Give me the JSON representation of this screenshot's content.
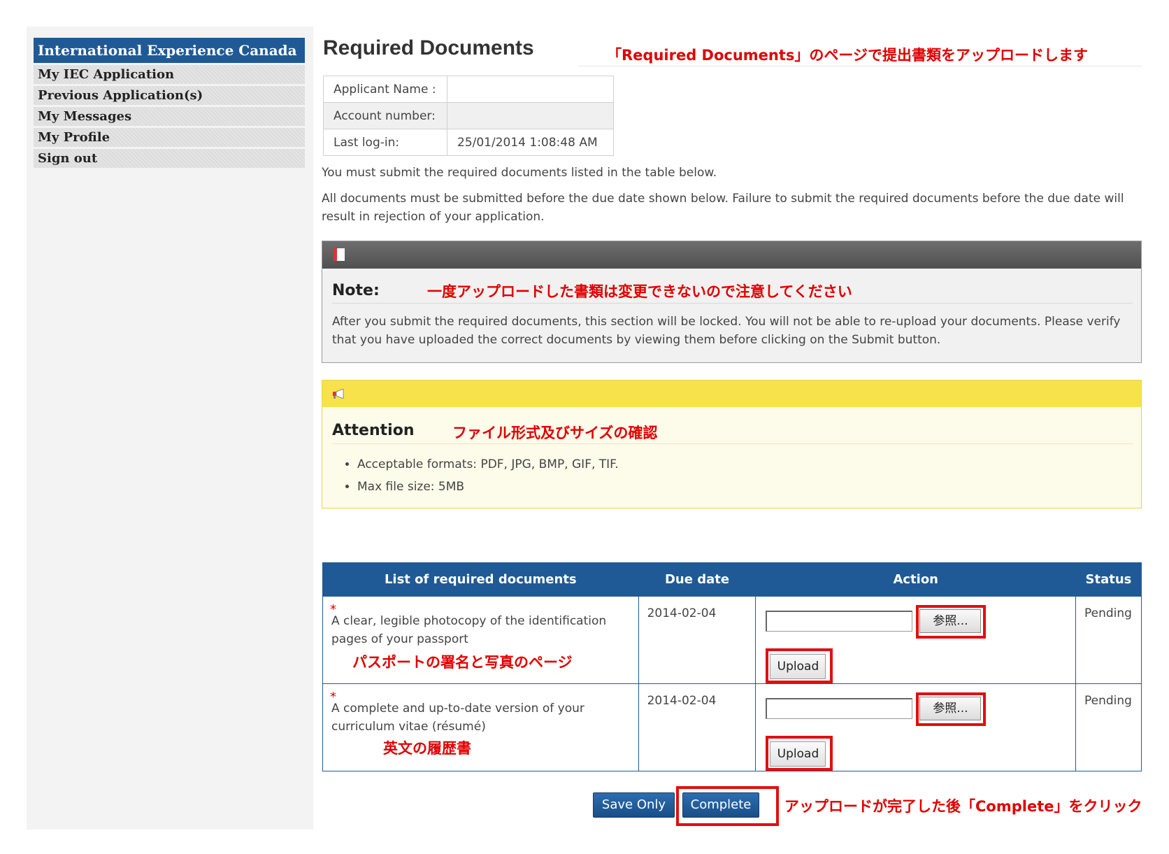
{
  "sidebar": {
    "header": "International Experience Canada",
    "items": [
      {
        "label": "My IEC Application"
      },
      {
        "label": "Previous Application(s)"
      },
      {
        "label": "My Messages"
      },
      {
        "label": "My Profile"
      },
      {
        "label": "Sign out"
      }
    ]
  },
  "page": {
    "title": "Required Documents",
    "title_annotation": "「Required Documents」のページで提出書類をアップロードします"
  },
  "applicant": {
    "rows": [
      {
        "label": "Applicant Name :",
        "value": ""
      },
      {
        "label": "Account number:",
        "value": ""
      },
      {
        "label": "Last log-in:",
        "value": "25/01/2014 1:08:48 AM"
      }
    ]
  },
  "intro": {
    "line1": "You must submit the required documents listed in the table below.",
    "line2": "All documents must be submitted before the due date shown below. Failure to submit the required documents before the due date will result in rejection of your application."
  },
  "note": {
    "title": "Note:",
    "annotation": "一度アップロードした書類は変更できないので注意してください",
    "text": "After you submit the required documents, this section will be locked. You will not be able to re-upload your documents. Please verify that you have uploaded the correct documents by viewing them before clicking on the Submit button."
  },
  "attention": {
    "title": "Attention",
    "annotation": "ファイル形式及びサイズの確認",
    "items": [
      "Acceptable formats: PDF, JPG, BMP, GIF, TIF.",
      "Max file size: 5MB"
    ]
  },
  "documents": {
    "headers": {
      "name": "List of required documents",
      "due": "Due date",
      "action": "Action",
      "status": "Status"
    },
    "required_mark": "*",
    "browse_label": "参照...",
    "upload_label": "Upload",
    "rows": [
      {
        "name": "A clear, legible photocopy of the identification pages of your passport",
        "annotation": "パスポートの署名と写真のページ",
        "due": "2014-02-04",
        "status": "Pending"
      },
      {
        "name": "A complete and up-to-date version of your curriculum vitae (résumé)",
        "annotation": "英文の履歴書",
        "due": "2014-02-04",
        "status": "Pending"
      }
    ]
  },
  "footer": {
    "save_only": "Save Only",
    "complete": "Complete",
    "annotation": "アップロードが完了した後「Complete」をクリック"
  },
  "colors": {
    "brand_blue": "#1f5a96",
    "annotation_red": "#e00000",
    "attention_yellow": "#f7e24b"
  }
}
